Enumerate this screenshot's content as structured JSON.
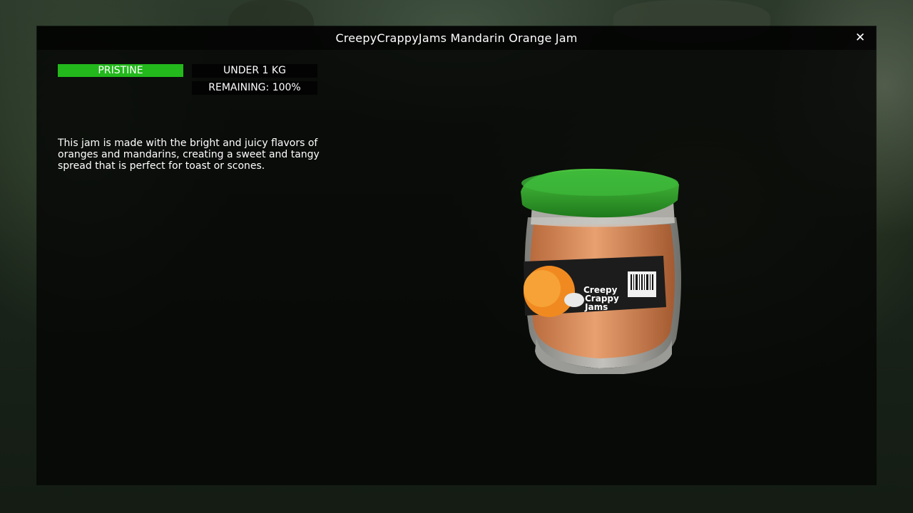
{
  "window": {
    "title": "CreepyCrappyJams Mandarin Orange Jam",
    "close_glyph": "✕"
  },
  "item": {
    "condition": "PRISTINE",
    "weight": "UNDER 1 KG",
    "remaining": "REMAINING: 100%",
    "description": "This jam is made with the bright and juicy flavors of oranges and mandarins, creating a sweet and tangy spread that is perfect for toast or scones.",
    "label_text": [
      "Creepy",
      "Crappy",
      "Jams"
    ]
  },
  "colors": {
    "condition_good": "#23b81c",
    "lid_green": "#2fa52a",
    "jam_orange": "#e08850"
  },
  "icons": {
    "close": "close-icon",
    "item_preview": "jam-jar"
  }
}
